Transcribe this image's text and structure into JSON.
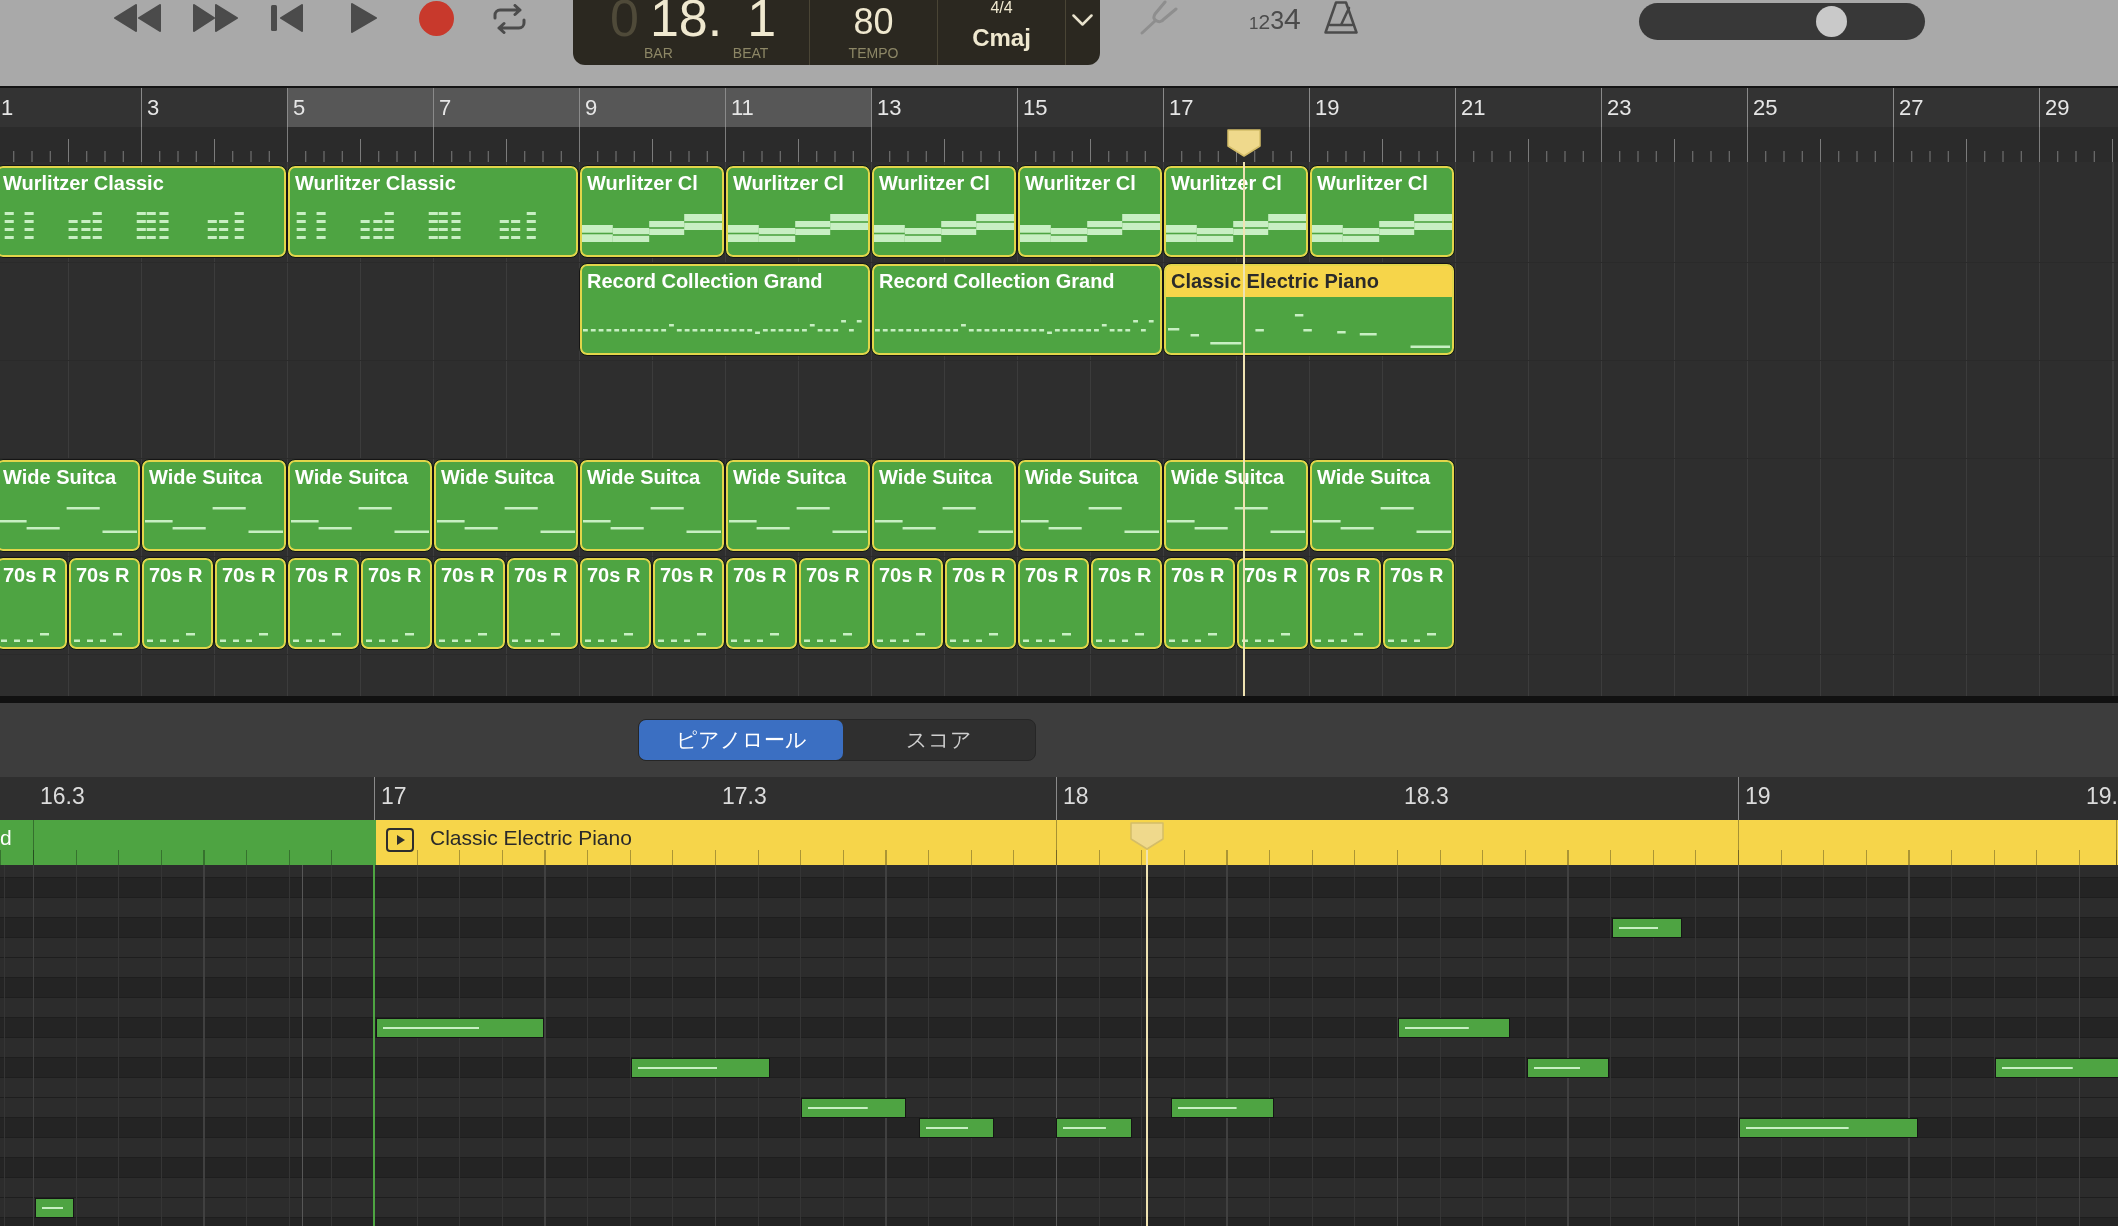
{
  "transport": [
    {
      "kind": "rewind"
    },
    {
      "kind": "fast_forward"
    },
    {
      "kind": "go_to_start"
    },
    {
      "kind": "play"
    },
    {
      "kind": "record"
    }
  ],
  "cycle": {
    "on": false
  },
  "lcd": {
    "bar_lead": "0",
    "bar": "18.",
    "beat": "1",
    "bar_caption": "BAR",
    "beat_caption": "BEAT",
    "tempo": "80",
    "tempo_caption": "TEMPO",
    "time_signature": "4/4",
    "key": "Cmaj"
  },
  "tuner": {
    "disabled": true
  },
  "count_in": {
    "label": "1234",
    "on": false
  },
  "metronome": {
    "on": false
  },
  "master_volume": {
    "level": 0.7
  },
  "ruler": {
    "bars": [
      "1",
      "3",
      "5",
      "7",
      "9",
      "11",
      "13",
      "15",
      "17",
      "19",
      "21",
      "23",
      "25",
      "27",
      "29"
    ]
  },
  "tracks": [
    {
      "regions": [
        {
          "label": "Wurlitzer Classic",
          "selected": false
        },
        {
          "label": "Wurlitzer Classic",
          "selected": false
        },
        {
          "label": "Wurlitzer Cl",
          "selected": false
        },
        {
          "label": "Wurlitzer Cl",
          "selected": false
        },
        {
          "label": "Wurlitzer Cl",
          "selected": false
        },
        {
          "label": "Wurlitzer Cl",
          "selected": false
        },
        {
          "label": "Wurlitzer Cl",
          "selected": false
        },
        {
          "label": "Wurlitzer Cl",
          "selected": false
        }
      ]
    },
    {
      "regions": [
        {
          "label": "Record Collection Grand",
          "selected": false
        },
        {
          "label": "Record Collection Grand",
          "selected": false
        },
        {
          "label": "Classic Electric Piano",
          "selected": true
        }
      ]
    },
    {
      "regions": [
        {
          "label": "Wide Suitca",
          "selected": false
        },
        {
          "label": "Wide Suitca",
          "selected": false
        },
        {
          "label": "Wide Suitca",
          "selected": false
        },
        {
          "label": "Wide Suitca",
          "selected": false
        },
        {
          "label": "Wide Suitca",
          "selected": false
        },
        {
          "label": "Wide Suitca",
          "selected": false
        },
        {
          "label": "Wide Suitca",
          "selected": false
        },
        {
          "label": "Wide Suitca",
          "selected": false
        },
        {
          "label": "Wide Suitca",
          "selected": false
        },
        {
          "label": "Wide Suitca",
          "selected": false
        }
      ]
    },
    {
      "regions": [
        {
          "label": "70s R",
          "selected": false
        },
        {
          "label": "70s R",
          "selected": false
        },
        {
          "label": "70s R",
          "selected": false
        },
        {
          "label": "70s R",
          "selected": false
        },
        {
          "label": "70s R",
          "selected": false
        },
        {
          "label": "70s R",
          "selected": false
        },
        {
          "label": "70s R",
          "selected": false
        },
        {
          "label": "70s R",
          "selected": false
        },
        {
          "label": "70s R",
          "selected": false
        },
        {
          "label": "70s R",
          "selected": false
        },
        {
          "label": "70s R",
          "selected": false
        },
        {
          "label": "70s R",
          "selected": false
        },
        {
          "label": "70s R",
          "selected": false
        },
        {
          "label": "70s R",
          "selected": false
        },
        {
          "label": "70s R",
          "selected": false
        },
        {
          "label": "70s R",
          "selected": false
        },
        {
          "label": "70s R",
          "selected": false
        },
        {
          "label": "70s R",
          "selected": false
        },
        {
          "label": "70s R",
          "selected": false
        },
        {
          "label": "70s R",
          "selected": false
        }
      ]
    }
  ],
  "editor": {
    "tabs": [
      {
        "label": "ピアノロール",
        "selected": true
      },
      {
        "label": "スコア",
        "selected": false
      }
    ],
    "ruler": [
      "16.3",
      "17",
      "17.3",
      "18",
      "18.3",
      "19",
      "19."
    ],
    "regions": [
      {
        "label": "d",
        "selected": false
      },
      {
        "label": "Classic Electric Piano",
        "selected": true
      }
    ]
  }
}
